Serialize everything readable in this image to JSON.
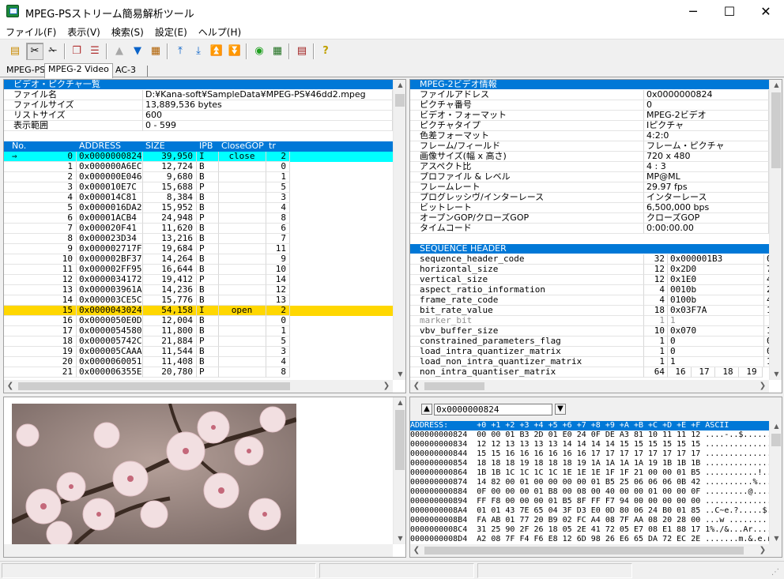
{
  "window": {
    "title": "MPEG-PSストリーム簡易解析ツール",
    "minimize": "─",
    "maximize": "☐",
    "close": "✕"
  },
  "menu": [
    "ファイル(F)",
    "表示(V)",
    "検索(S)",
    "設定(E)",
    "ヘルプ(H)"
  ],
  "tabs": [
    "MPEG-PS",
    "MPEG-2 Video",
    "AC-3"
  ],
  "picture_list": {
    "header": "ビデオ・ピクチャ一覧",
    "info": [
      [
        "ファイル名",
        "D:¥Kana-soft¥SampleData¥MPEG-PS¥46dd2.mpeg"
      ],
      [
        "ファイルサイズ",
        "13,889,536 bytes"
      ],
      [
        "リストサイズ",
        "600"
      ],
      [
        "表示範囲",
        "0 - 599"
      ]
    ],
    "columns": [
      "No.",
      "ADDRESS",
      "SIZE",
      "IPB",
      "CloseGOP",
      "tr"
    ],
    "current_marker": "⇒",
    "rows": [
      [
        "0",
        "0x0000000824",
        "39,950",
        "I",
        "close",
        "2"
      ],
      [
        "1",
        "0x000000A6EC",
        "12,724",
        "B",
        "",
        "0"
      ],
      [
        "2",
        "0x000000E046",
        "9,680",
        "B",
        "",
        "1"
      ],
      [
        "3",
        "0x000010E7C",
        "15,688",
        "P",
        "",
        "5"
      ],
      [
        "4",
        "0x000014C81",
        "8,384",
        "B",
        "",
        "3"
      ],
      [
        "5",
        "0x0000016DA2",
        "15,952",
        "B",
        "",
        "4"
      ],
      [
        "6",
        "0x00001ACB4",
        "24,948",
        "P",
        "",
        "8"
      ],
      [
        "7",
        "0x000020F41",
        "11,620",
        "B",
        "",
        "6"
      ],
      [
        "8",
        "0x000023D34",
        "13,216",
        "B",
        "",
        "7"
      ],
      [
        "9",
        "0x000002717F",
        "19,684",
        "P",
        "",
        "11"
      ],
      [
        "10",
        "0x000002BF37",
        "14,264",
        "B",
        "",
        "9"
      ],
      [
        "11",
        "0x000002FF95",
        "16,644",
        "B",
        "",
        "10"
      ],
      [
        "12",
        "0x0000034172",
        "19,412",
        "P",
        "",
        "14"
      ],
      [
        "13",
        "0x000003961A",
        "14,236",
        "B",
        "",
        "12"
      ],
      [
        "14",
        "0x000003CE5C",
        "15,776",
        "B",
        "",
        "13"
      ],
      [
        "15",
        "0x0000043024",
        "54,158",
        "I",
        "open",
        "2"
      ],
      [
        "16",
        "0x0000050E0D",
        "12,004",
        "B",
        "",
        "0"
      ],
      [
        "17",
        "0x0000054580",
        "11,800",
        "B",
        "",
        "1"
      ],
      [
        "18",
        "0x000005742C",
        "21,884",
        "P",
        "",
        "5"
      ],
      [
        "19",
        "0x000005CAAA",
        "11,544",
        "B",
        "",
        "3"
      ],
      [
        "20",
        "0x0000060051",
        "11,408",
        "B",
        "",
        "4"
      ],
      [
        "21",
        "0x000006355E",
        "20,780",
        "P",
        "",
        "8"
      ]
    ]
  },
  "video_info": {
    "header": "MPEG-2ビデオ情報",
    "rows": [
      [
        "ファイルアドレス",
        "0x0000000824"
      ],
      [
        "ピクチャ番号",
        "0"
      ],
      [
        "ビデオ・フォーマット",
        "MPEG-2ビデオ"
      ],
      [
        "ピクチャタイプ",
        "Iピクチャ"
      ],
      [
        "色差フォーマット",
        "4:2:0"
      ],
      [
        "フレーム/フィールド",
        "フレーム・ピクチャ"
      ],
      [
        "画像サイズ(幅 x 高さ)",
        "720 x 480"
      ],
      [
        "アスペクト比",
        "4 : 3"
      ],
      [
        "プロファイル & レベル",
        "MP@ML"
      ],
      [
        "フレームレート",
        "29.97 fps"
      ],
      [
        "プログレッシヴ/インターレース",
        "インターレース"
      ],
      [
        "ビットレート",
        "6,500,000 bps"
      ],
      [
        "オープンGOP/クローズGOP",
        "クローズGOP"
      ],
      [
        "タイムコード",
        "0:00:00.00"
      ]
    ]
  },
  "sequence_header": {
    "header": "SEQUENCE HEADER",
    "rows": [
      [
        "sequence_header_code",
        "32",
        "0x000001B3",
        "0"
      ],
      [
        "horizontal_size",
        "12",
        "0x2D0",
        "7"
      ],
      [
        "vertical_size",
        "12",
        "0x1E0",
        "4"
      ],
      [
        "aspect_ratio_information",
        "4",
        "0010b",
        "2"
      ],
      [
        "frame_rate_code",
        "4",
        "0100b",
        "4"
      ],
      [
        "bit_rate_value",
        "18",
        "0x03F7A",
        "1"
      ],
      [
        "marker_bit",
        "1",
        "1",
        ""
      ],
      [
        "vbv_buffer_size",
        "10",
        "0x070",
        "1"
      ],
      [
        "constrained_parameters_flag",
        "1",
        "0",
        "0"
      ],
      [
        "load_intra_quantizer_matrix",
        "1",
        "0",
        "0"
      ],
      [
        "load_non_intra_quantizer_matrix",
        "1",
        "1",
        "1"
      ]
    ],
    "last_row": {
      "name": "non_intra_quantiser_matrix",
      "bits": "64",
      "values": [
        "16",
        "17",
        "18",
        "19"
      ]
    }
  },
  "hex_view": {
    "address_value": "0x0000000824",
    "header": "ADDRESS:      +0 +1 +2 +3 +4 +5 +6 +7 +8 +9 +A +B +C +D +E +F ASCII",
    "lines": [
      "000000000824  00 00 01 B3 2D 01 E0 24 0F DE A3 81 10 11 11 12 ....-..$........",
      "000000000834  12 12 13 13 13 13 14 14 14 14 15 15 15 15 15 15 ................",
      "000000000844  15 15 16 16 16 16 16 16 17 17 17 17 17 17 17 17 ................",
      "000000000854  18 18 18 19 18 18 18 19 1A 1A 1A 1A 19 1B 1B 1B ................",
      "000000000864  1B 1B 1C 1C 1C 1C 1E 1E 1E 1F 1F 21 00 00 01 B5 ...........!....",
      "000000000874  14 82 00 01 00 00 00 00 01 B5 25 06 06 06 0B 42 ..........%....B",
      "000000000884  0F 00 00 00 01 B8 00 08 00 40 00 00 01 00 00 0F .........@......",
      "000000000894  FF F8 00 00 00 01 B5 8F FF F7 94 00 00 00 00 00 ................",
      "0000000008A4  01 01 43 7E 65 04 3F D3 E0 0D 80 06 24 B0 01 85 ..C~e.?.....$...",
      "0000000008B4  FA AB 01 77 20 B9 02 FC A4 08 7F AA 08 20 28 00 ...w ........ (.",
      "0000000008C4  31 25 90 2F 26 18 05 2E 41 72 05 E7 08 E1 88 17 1%./&...Ar......",
      "0000000008D4  A2 08 7F F4 F6 E8 12 6D 98 26 E6 65 DA 72 EC 2E .......m.&.e.r.."
    ]
  }
}
